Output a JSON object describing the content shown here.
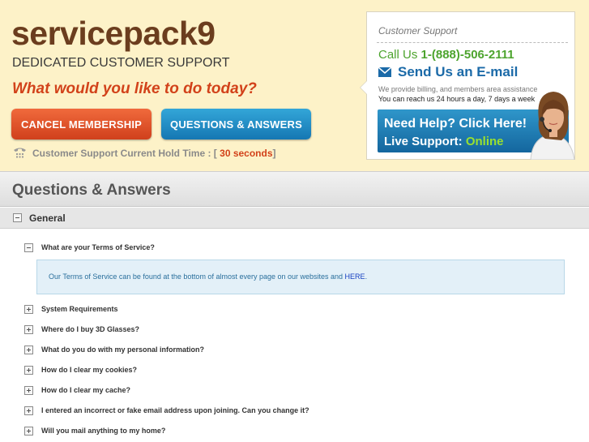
{
  "header": {
    "brand": "servicepack9",
    "tagline": "DEDICATED CUSTOMER SUPPORT",
    "question": "What would you like to do today?",
    "cancel_label": "CANCEL MEMBERSHIP",
    "qa_label": "QUESTIONS & ANSWERS",
    "hold_label": "Customer Support Current Hold Time : [",
    "hold_value": "30 seconds",
    "hold_close": " ]"
  },
  "support": {
    "title": "Customer Support",
    "call_prefix": "Call Us ",
    "phone": "1-(888)-506-2111",
    "email_label": "Send Us an E-mail",
    "info_line1": "We provide billing, and members area assistance",
    "info_line2": "You can reach us 24 hours a day, 7 days a week",
    "help_title": "Need Help? Click Here!",
    "live_prefix": "Live Support: ",
    "live_status": "Online"
  },
  "faq": {
    "heading": "Questions & Answers",
    "section": "General",
    "open_question": "What are your Terms of Service?",
    "answer_text": "Our Terms of Service can be found at the bottom of almost every page on our websites and ",
    "answer_link": "HERE",
    "answer_end": ".",
    "questions": [
      "System Requirements",
      "Where do I buy 3D Glasses?",
      "What do you do with my personal information?",
      "How do I clear my cookies?",
      "How do I clear my cache?",
      "I entered an incorrect or fake email address upon joining. Can you change it?",
      "Will you mail anything to my home?"
    ]
  },
  "colors": {
    "header_bg": "#fdf2c8",
    "brand": "#6b3d1e",
    "accent_orange": "#d2421a",
    "accent_blue": "#1b6aa8",
    "live_green": "#9ae02f"
  },
  "icons": [
    "phone-icon",
    "mail-icon",
    "collapse-icon",
    "expand-icon",
    "support-agent-icon"
  ]
}
